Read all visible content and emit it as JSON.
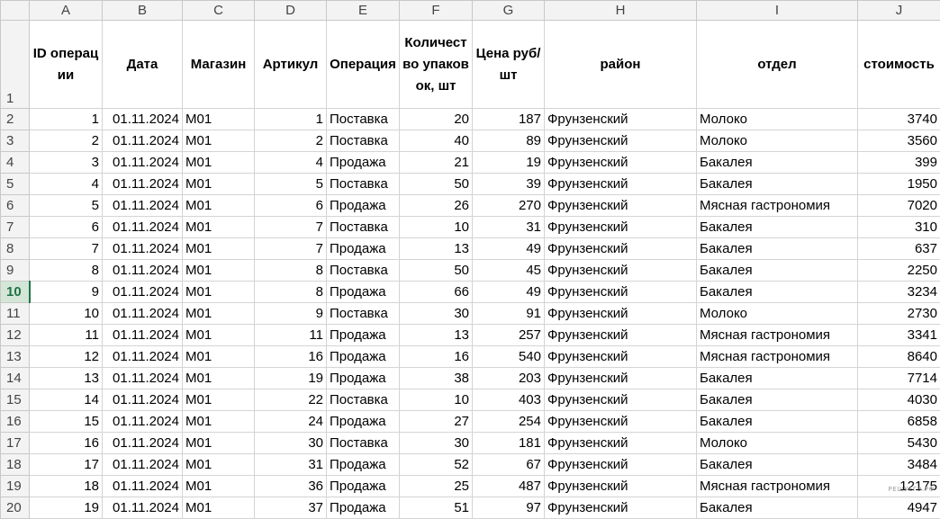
{
  "columns": [
    "A",
    "B",
    "C",
    "D",
    "E",
    "F",
    "G",
    "H",
    "I",
    "J"
  ],
  "active_row": 10,
  "header_row_number": 1,
  "headers": [
    "ID операции",
    "Дата",
    "Магазин",
    "Артикул",
    "Операция",
    "Количество упаковок, шт",
    "Цена руб/шт",
    "район",
    "отдел",
    "стоимость"
  ],
  "rows": [
    {
      "n": 2,
      "id": "1",
      "date": "01.11.2024",
      "shop": "M01",
      "art": "1",
      "op": "Поставка",
      "qty": "20",
      "price": "187",
      "district": "Фрунзенский",
      "dept": "Молоко",
      "cost": "3740"
    },
    {
      "n": 3,
      "id": "2",
      "date": "01.11.2024",
      "shop": "M01",
      "art": "2",
      "op": "Поставка",
      "qty": "40",
      "price": "89",
      "district": "Фрунзенский",
      "dept": "Молоко",
      "cost": "3560"
    },
    {
      "n": 4,
      "id": "3",
      "date": "01.11.2024",
      "shop": "M01",
      "art": "4",
      "op": "Продажа",
      "qty": "21",
      "price": "19",
      "district": "Фрунзенский",
      "dept": "Бакалея",
      "cost": "399"
    },
    {
      "n": 5,
      "id": "4",
      "date": "01.11.2024",
      "shop": "M01",
      "art": "5",
      "op": "Поставка",
      "qty": "50",
      "price": "39",
      "district": "Фрунзенский",
      "dept": "Бакалея",
      "cost": "1950"
    },
    {
      "n": 6,
      "id": "5",
      "date": "01.11.2024",
      "shop": "M01",
      "art": "6",
      "op": "Продажа",
      "qty": "26",
      "price": "270",
      "district": "Фрунзенский",
      "dept": "Мясная гастрономия",
      "cost": "7020"
    },
    {
      "n": 7,
      "id": "6",
      "date": "01.11.2024",
      "shop": "M01",
      "art": "7",
      "op": "Поставка",
      "qty": "10",
      "price": "31",
      "district": "Фрунзенский",
      "dept": "Бакалея",
      "cost": "310"
    },
    {
      "n": 8,
      "id": "7",
      "date": "01.11.2024",
      "shop": "M01",
      "art": "7",
      "op": "Продажа",
      "qty": "13",
      "price": "49",
      "district": "Фрунзенский",
      "dept": "Бакалея",
      "cost": "637"
    },
    {
      "n": 9,
      "id": "8",
      "date": "01.11.2024",
      "shop": "M01",
      "art": "8",
      "op": "Поставка",
      "qty": "50",
      "price": "45",
      "district": "Фрунзенский",
      "dept": "Бакалея",
      "cost": "2250"
    },
    {
      "n": 10,
      "id": "9",
      "date": "01.11.2024",
      "shop": "M01",
      "art": "8",
      "op": "Продажа",
      "qty": "66",
      "price": "49",
      "district": "Фрунзенский",
      "dept": "Бакалея",
      "cost": "3234"
    },
    {
      "n": 11,
      "id": "10",
      "date": "01.11.2024",
      "shop": "M01",
      "art": "9",
      "op": "Поставка",
      "qty": "30",
      "price": "91",
      "district": "Фрунзенский",
      "dept": "Молоко",
      "cost": "2730"
    },
    {
      "n": 12,
      "id": "11",
      "date": "01.11.2024",
      "shop": "M01",
      "art": "11",
      "op": "Продажа",
      "qty": "13",
      "price": "257",
      "district": "Фрунзенский",
      "dept": "Мясная гастрономия",
      "cost": "3341"
    },
    {
      "n": 13,
      "id": "12",
      "date": "01.11.2024",
      "shop": "M01",
      "art": "16",
      "op": "Продажа",
      "qty": "16",
      "price": "540",
      "district": "Фрунзенский",
      "dept": "Мясная гастрономия",
      "cost": "8640"
    },
    {
      "n": 14,
      "id": "13",
      "date": "01.11.2024",
      "shop": "M01",
      "art": "19",
      "op": "Продажа",
      "qty": "38",
      "price": "203",
      "district": "Фрунзенский",
      "dept": "Бакалея",
      "cost": "7714"
    },
    {
      "n": 15,
      "id": "14",
      "date": "01.11.2024",
      "shop": "M01",
      "art": "22",
      "op": "Поставка",
      "qty": "10",
      "price": "403",
      "district": "Фрунзенский",
      "dept": "Бакалея",
      "cost": "4030"
    },
    {
      "n": 16,
      "id": "15",
      "date": "01.11.2024",
      "shop": "M01",
      "art": "24",
      "op": "Продажа",
      "qty": "27",
      "price": "254",
      "district": "Фрунзенский",
      "dept": "Бакалея",
      "cost": "6858"
    },
    {
      "n": 17,
      "id": "16",
      "date": "01.11.2024",
      "shop": "M01",
      "art": "30",
      "op": "Поставка",
      "qty": "30",
      "price": "181",
      "district": "Фрунзенский",
      "dept": "Молоко",
      "cost": "5430"
    },
    {
      "n": 18,
      "id": "17",
      "date": "01.11.2024",
      "shop": "M01",
      "art": "31",
      "op": "Продажа",
      "qty": "52",
      "price": "67",
      "district": "Фрунзенский",
      "dept": "Бакалея",
      "cost": "3484"
    },
    {
      "n": 19,
      "id": "18",
      "date": "01.11.2024",
      "shop": "M01",
      "art": "36",
      "op": "Продажа",
      "qty": "25",
      "price": "487",
      "district": "Фрунзенский",
      "dept": "Мясная гастрономия",
      "cost": "12175"
    },
    {
      "n": 20,
      "id": "19",
      "date": "01.11.2024",
      "shop": "M01",
      "art": "37",
      "op": "Продажа",
      "qty": "51",
      "price": "97",
      "district": "Фрунзенский",
      "dept": "Бакалея",
      "cost": "4947"
    }
  ],
  "watermark": "РЕШУЕГЭ.РФ",
  "colors": {
    "grid": "#d4d4d4",
    "header_bg": "#f3f3f3",
    "active_row_bg": "#d3e6d7",
    "active_row_text": "#217346"
  }
}
